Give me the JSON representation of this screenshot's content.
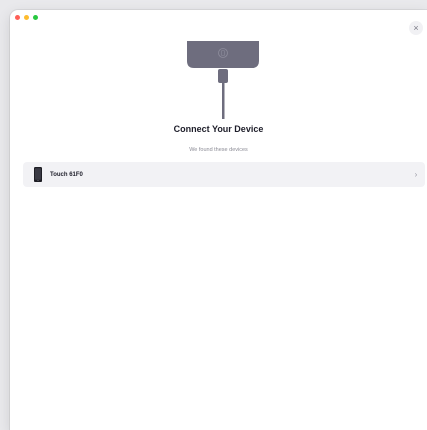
{
  "window": {
    "controls": {
      "close_color": "#ff5f57",
      "minimize_color": "#febc2e",
      "zoom_color": "#28c840"
    },
    "close_button_glyph": "×"
  },
  "illustration": {
    "icon": "phone-connect-illustration",
    "color": "#6e6d7e"
  },
  "main": {
    "title": "Connect Your Device",
    "subtitle": "We found these devices"
  },
  "devices": [
    {
      "name": "Touch 61F0",
      "icon": "phone-icon",
      "chevron": "›"
    }
  ]
}
